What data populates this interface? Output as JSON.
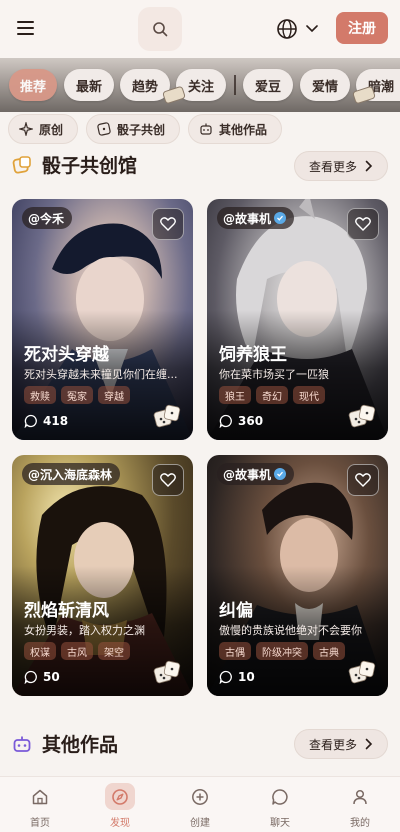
{
  "header": {
    "register_label": "注册"
  },
  "tabs": [
    "推荐",
    "最新",
    "趋势",
    "关注",
    "爱豆",
    "爱情",
    "暗潮"
  ],
  "chips": [
    "原创",
    "骰子共创",
    "其他作品"
  ],
  "section1": {
    "title": "骰子共创馆",
    "see_more": "查看更多"
  },
  "cards": [
    {
      "author": "@今禾",
      "verified": false,
      "title": "死对头穿越",
      "desc": "死对头穿越未来撞见你们在缠...",
      "tags": [
        "救赎",
        "冤家",
        "穿越"
      ],
      "count": "418"
    },
    {
      "author": "@故事机",
      "verified": true,
      "title": "饲养狼王",
      "desc": "你在菜市场买了一匹狼",
      "tags": [
        "狼王",
        "奇幻",
        "现代"
      ],
      "count": "360"
    },
    {
      "author": "@沉入海底森林",
      "verified": false,
      "title": "烈焰斩清风",
      "desc": "女扮男装，踏入权力之渊",
      "tags": [
        "权谋",
        "古风",
        "架空"
      ],
      "count": "50"
    },
    {
      "author": "@故事机",
      "verified": true,
      "title": "纠偏",
      "desc": "傲慢的贵族说他绝对不会要你",
      "tags": [
        "古偶",
        "阶级冲突",
        "古典"
      ],
      "count": "10"
    }
  ],
  "section2": {
    "title": "其他作品",
    "see_more": "查看更多"
  },
  "nav": [
    {
      "label": "首页",
      "icon": "home-icon"
    },
    {
      "label": "发现",
      "icon": "compass-icon",
      "active": true
    },
    {
      "label": "创建",
      "icon": "plus-circle-icon"
    },
    {
      "label": "聊天",
      "icon": "chat-icon"
    },
    {
      "label": "我的",
      "icon": "user-icon"
    }
  ],
  "colors": {
    "accent": "#d37a6a",
    "background": "#f7f3f0",
    "text": "#2a1e1a"
  }
}
